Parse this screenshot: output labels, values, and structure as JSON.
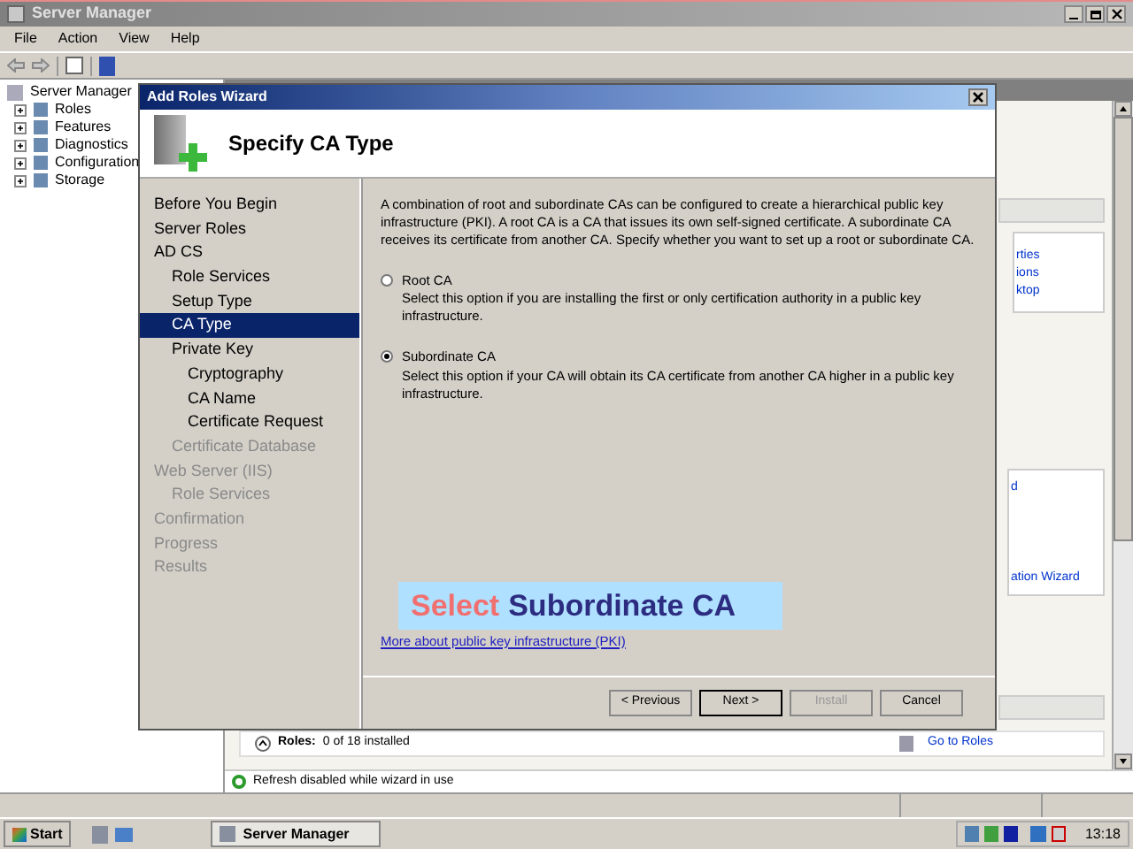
{
  "window": {
    "title": "Server Manager"
  },
  "menu": [
    "File",
    "Action",
    "View",
    "Help"
  ],
  "tree": {
    "root": "Server Manager",
    "items": [
      {
        "label": "Roles",
        "expanded": false
      },
      {
        "label": "Features",
        "expanded": false
      },
      {
        "label": "Diagnostics",
        "expanded": false
      },
      {
        "label": "Configuration",
        "expanded": false
      },
      {
        "label": "Storage",
        "expanded": false
      }
    ]
  },
  "background_pane": {
    "links_top": [
      "rties",
      "ions",
      "ktop"
    ],
    "links_middle": [
      "d",
      "ation Wizard"
    ],
    "roles_summary": "Roles:",
    "roles_count": "0 of 18 installed",
    "go_to_roles": "Go to Roles",
    "refresh_note": "Refresh disabled while wizard in use"
  },
  "wizard": {
    "title": "Add Roles Wizard",
    "heading": "Specify CA Type",
    "nav": [
      {
        "label": "Before You Begin",
        "selected": false,
        "disabled": false
      },
      {
        "label": "Server Roles",
        "selected": false,
        "disabled": false
      },
      {
        "label": "AD CS",
        "selected": false,
        "disabled": false,
        "children": [
          {
            "label": "Role Services",
            "selected": false,
            "disabled": false
          },
          {
            "label": "Setup Type",
            "selected": false,
            "disabled": false
          },
          {
            "label": "CA Type",
            "selected": true,
            "disabled": false
          },
          {
            "label": "Private Key",
            "selected": false,
            "disabled": false,
            "children": [
              {
                "label": "Cryptography",
                "selected": false,
                "disabled": false
              },
              {
                "label": "CA Name",
                "selected": false,
                "disabled": false
              },
              {
                "label": "Certificate Request",
                "selected": false,
                "disabled": false
              }
            ]
          },
          {
            "label": "Certificate Database",
            "selected": false,
            "disabled": true
          }
        ]
      },
      {
        "label": "Web Server (IIS)",
        "selected": false,
        "disabled": true,
        "children": [
          {
            "label": "Role Services",
            "selected": false,
            "disabled": true
          }
        ]
      },
      {
        "label": "Confirmation",
        "selected": false,
        "disabled": true
      },
      {
        "label": "Progress",
        "selected": false,
        "disabled": true
      },
      {
        "label": "Results",
        "selected": false,
        "disabled": true
      }
    ],
    "intro": "A combination of root and subordinate CAs can be configured to create a hierarchical public key infrastructure (PKI). A root CA is a CA that issues its own self-signed certificate. A subordinate CA receives its certificate from another CA. Specify whether you want to set up a root or subordinate CA.",
    "options": [
      {
        "label": "Root CA",
        "description": "Select this option if you are installing the first or only certification authority in a public key infrastructure.",
        "selected": false
      },
      {
        "label": "Subordinate CA",
        "description": "Select this option if your CA will obtain its CA certificate from another CA higher in a public key infrastructure.",
        "selected": true
      }
    ],
    "link": "More about public key infrastructure (PKI)",
    "buttons": [
      {
        "label": "< Previous",
        "disabled": false,
        "default": false
      },
      {
        "label": "Next >",
        "disabled": false,
        "default": true
      },
      {
        "label": "Install",
        "disabled": true,
        "default": false
      },
      {
        "label": "Cancel",
        "disabled": false,
        "default": false
      }
    ]
  },
  "caption": {
    "highlight": "Select",
    "text": "Subordinate CA"
  },
  "taskbar": {
    "start": "Start",
    "task": "Server Manager",
    "clock": "13:18"
  }
}
